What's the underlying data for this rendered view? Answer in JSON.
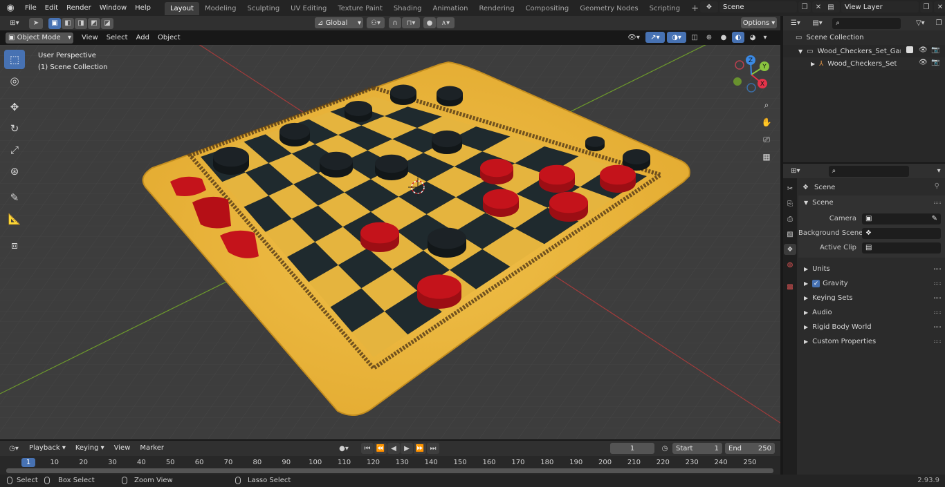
{
  "menu": {
    "file": "File",
    "edit": "Edit",
    "render": "Render",
    "window": "Window",
    "help": "Help"
  },
  "workspaces": [
    "Layout",
    "Modeling",
    "Sculpting",
    "UV Editing",
    "Texture Paint",
    "Shading",
    "Animation",
    "Rendering",
    "Compositing",
    "Geometry Nodes",
    "Scripting"
  ],
  "scene_field": "Scene",
  "view_layer_field": "View Layer",
  "viewport_header": {
    "mode": "Object Mode",
    "view": "View",
    "select": "Select",
    "add": "Add",
    "object": "Object",
    "orientation": "Global",
    "options": "Options"
  },
  "viewport_overlay": {
    "perspective": "User Perspective",
    "collection": "(1) Scene Collection"
  },
  "gizmo": {
    "x": "X",
    "y": "Y",
    "z": "Z"
  },
  "outliner": {
    "root": "Scene Collection",
    "items": [
      {
        "label": "Wood_Checkers_Set_Game_F"
      },
      {
        "label": "Wood_Checkers_Set_Gar"
      }
    ]
  },
  "properties": {
    "title": "Scene",
    "panel": "Scene",
    "camera_label": "Camera",
    "background_label": "Background Scene",
    "clip_label": "Active Clip",
    "sections": [
      "Units",
      "Gravity",
      "Keying Sets",
      "Audio",
      "Rigid Body World",
      "Custom Properties"
    ],
    "gravity_checked": true
  },
  "timeline": {
    "playback": "Playback",
    "keying": "Keying",
    "view": "View",
    "marker": "Marker",
    "current_frame": "1",
    "start_label": "Start",
    "start": "1",
    "end_label": "End",
    "end": "250",
    "ticks": [
      "1",
      "10",
      "20",
      "30",
      "40",
      "50",
      "60",
      "70",
      "80",
      "90",
      "100",
      "110",
      "120",
      "130",
      "140",
      "150",
      "160",
      "170",
      "180",
      "190",
      "200",
      "210",
      "220",
      "230",
      "240",
      "250"
    ]
  },
  "status": {
    "select": "Select",
    "box_select": "Box Select",
    "zoom_view": "Zoom View",
    "lasso_select": "Lasso Select",
    "version": "2.93.9"
  },
  "colors": {
    "accent": "#4772b3",
    "board": "#e9b43a",
    "red_piece": "#c4131b",
    "black_piece": "#1c2226"
  }
}
